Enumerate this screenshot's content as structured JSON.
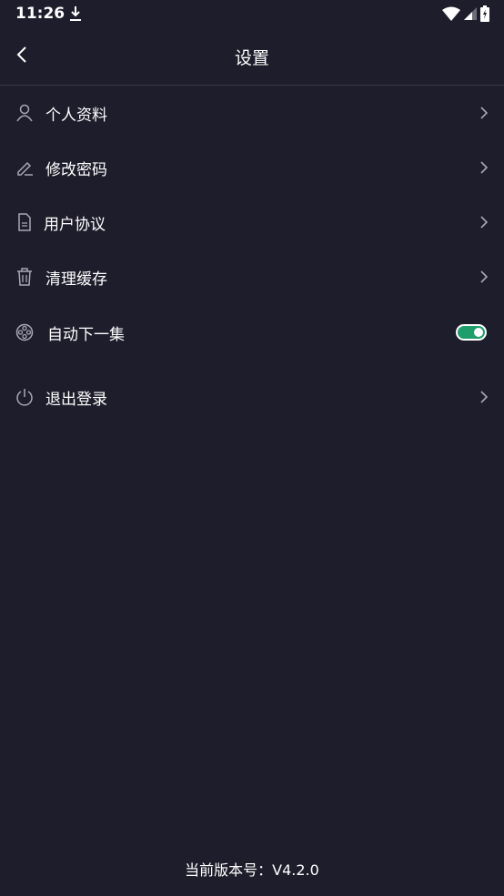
{
  "status_bar": {
    "time": "11:26"
  },
  "header": {
    "title": "设置"
  },
  "menu": {
    "items": [
      {
        "label": "个人资料",
        "icon": "user-icon"
      },
      {
        "label": "修改密码",
        "icon": "pencil-icon"
      },
      {
        "label": "用户协议",
        "icon": "document-icon"
      },
      {
        "label": "清理缓存",
        "icon": "trash-icon"
      },
      {
        "label": "自动下一集",
        "icon": "film-reel-icon",
        "toggle": true
      },
      {
        "label": "退出登录",
        "icon": "power-icon"
      }
    ]
  },
  "footer": {
    "version": "当前版本号：V4.2.0"
  },
  "colors": {
    "background": "#1e1d2b",
    "accent": "#1f9d6b",
    "divider": "#3a3947",
    "icon": "#a9a8b6"
  }
}
